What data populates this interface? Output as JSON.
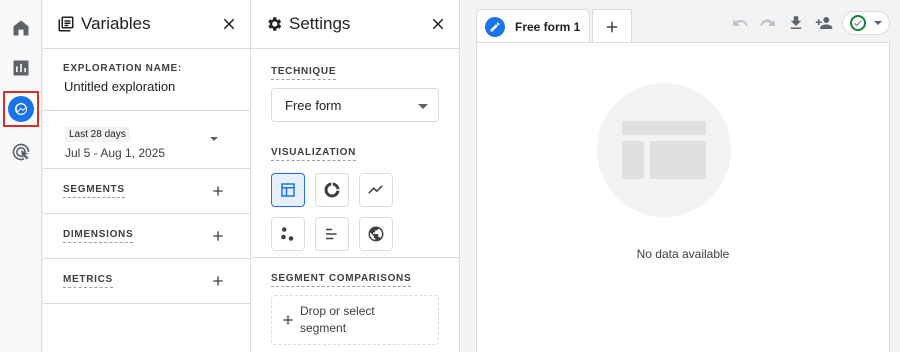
{
  "variables": {
    "title": "Variables",
    "exploration_label": "EXPLORATION NAME:",
    "exploration_value": "Untitled exploration",
    "date_chip": "Last 28 days",
    "date_range": "Jul 5 - Aug 1, 2025",
    "segments_label": "SEGMENTS",
    "dimensions_label": "DIMENSIONS",
    "metrics_label": "METRICS"
  },
  "settings": {
    "title": "Settings",
    "technique_label": "TECHNIQUE",
    "technique_value": "Free form",
    "visualization_label": "VISUALIZATION",
    "segment_comparisons_label": "SEGMENT COMPARISONS",
    "drop_segment_text_line1": "Drop or select",
    "drop_segment_text_line2": "segment"
  },
  "canvas": {
    "tab_label": "Free form 1",
    "empty_text": "No data available"
  },
  "colors": {
    "accent": "#1a73e8",
    "highlight_border": "#d93025",
    "status_ok": "#188038"
  }
}
